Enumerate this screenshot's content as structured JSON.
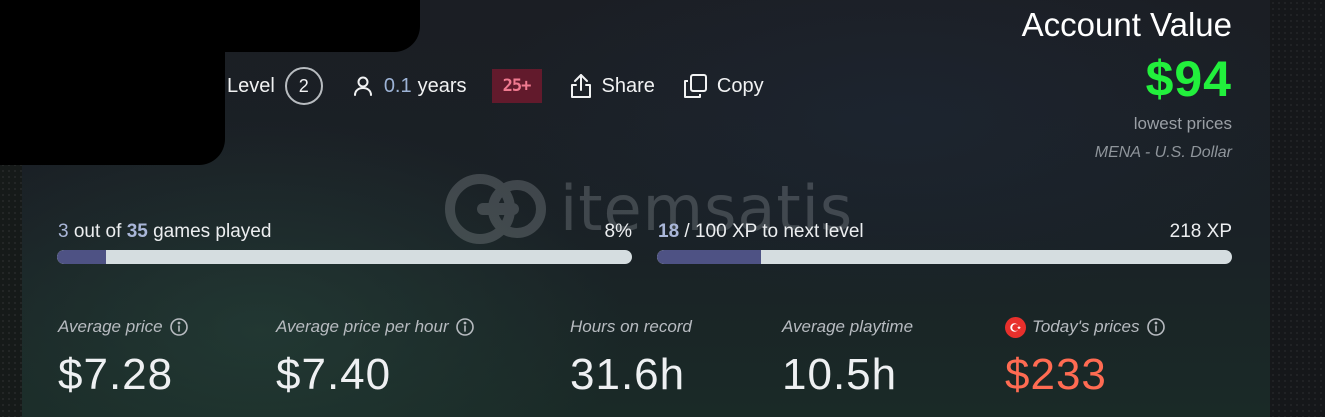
{
  "profile": {
    "level_label": "Level",
    "level": "2",
    "years_value": "0.1",
    "years_unit": "years",
    "age_badge": "25+",
    "share_label": "Share",
    "copy_label": "Copy",
    "user_icon": "user-icon",
    "share_icon": "share-icon",
    "copy_icon": "copy-icon"
  },
  "account": {
    "title": "Account Value",
    "value": "$94",
    "subtitle": "lowest prices",
    "region": "MENA - U.S. Dollar",
    "value_color": "#22f03c"
  },
  "watermark": {
    "text": "itemsatis"
  },
  "games_progress": {
    "played": "3",
    "out_of_text": "out of",
    "total": "35",
    "suffix": "games played",
    "percent_label": "8%",
    "fraction": 0.086
  },
  "xp_progress": {
    "current": "18",
    "rest_text": "/ 100 XP to next level",
    "total_label": "218 XP",
    "fraction": 0.18
  },
  "stats": [
    {
      "label": "Average price",
      "value": "$7.28",
      "info_icon": true
    },
    {
      "label": "Average price per hour",
      "value": "$7.40",
      "info_icon": true
    },
    {
      "label": "Hours on record",
      "value": "31.6h",
      "info_icon": false
    },
    {
      "label": "Average playtime",
      "value": "10.5h",
      "info_icon": false
    },
    {
      "label": "Today's prices",
      "value": "$233",
      "info_icon": true,
      "flag_icon": "turkey-flag-icon",
      "value_color": "#ff6b52"
    }
  ]
}
